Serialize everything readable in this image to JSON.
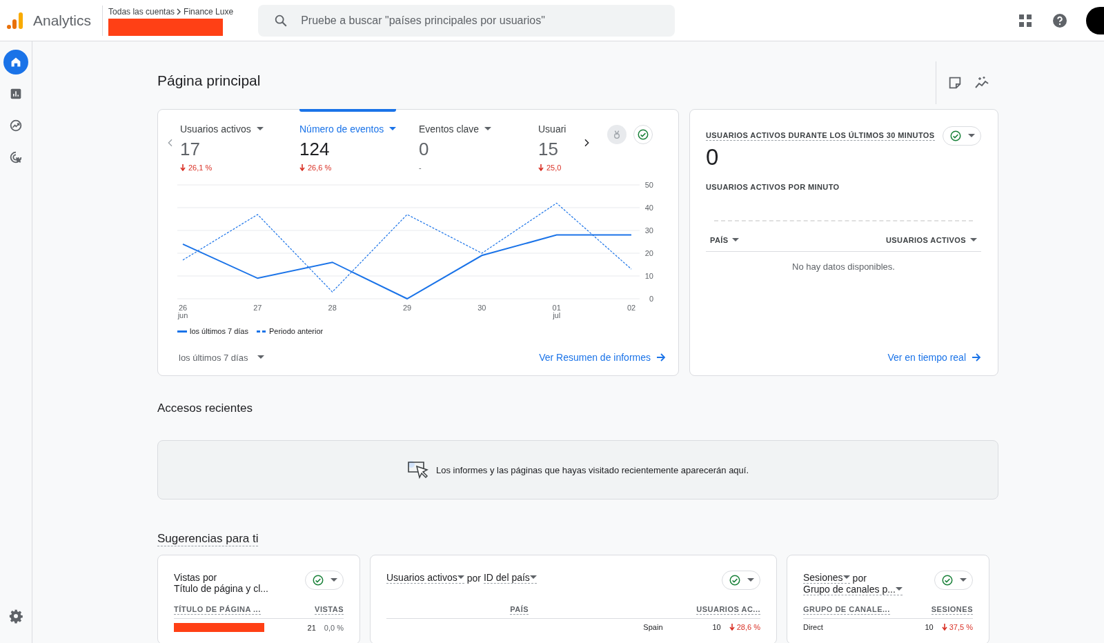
{
  "header": {
    "product": "Analytics",
    "breadcrumb": [
      "Todas las cuentas",
      "Finance Luxe"
    ],
    "search": {
      "placeholder": "Pruebe a buscar \"países principales por usuarios\""
    }
  },
  "sidebar": {
    "items": [
      {
        "selected": true
      },
      {
        "selected": false
      },
      {
        "selected": false
      },
      {
        "selected": false
      }
    ]
  },
  "page_title": "Página principal",
  "overview": {
    "metrics": [
      {
        "label": "Usuarios activos",
        "value": "17",
        "change": "26,1 %",
        "decrease": true,
        "selected": false
      },
      {
        "label": "Número de eventos",
        "value": "124",
        "change": "26,6 %",
        "decrease": true,
        "selected": true
      },
      {
        "label": "Eventos clave",
        "value": "0",
        "change": "-",
        "decrease": false,
        "selected": false
      },
      {
        "label": "Usuari",
        "value": "15",
        "change": "25,0",
        "decrease": true,
        "selected": false
      }
    ],
    "chart_data": {
      "type": "line",
      "grid": true,
      "categories": [
        "26 jun",
        "27",
        "28",
        "29",
        "30",
        "01 jul",
        "02"
      ],
      "ylim": [
        0,
        50
      ],
      "yticks": [
        0,
        10,
        20,
        30,
        40,
        50
      ],
      "series": [
        {
          "name": "los últimos 7 días",
          "color": "#1a73e8",
          "line_style": "solid",
          "values": [
            24,
            9,
            16,
            0,
            19,
            28,
            28
          ]
        },
        {
          "name": "Periodo anterior",
          "color": "#1a73e8",
          "line_style": "dashed",
          "values": [
            17,
            37,
            3,
            37,
            20,
            42,
            13
          ]
        }
      ]
    },
    "date_range": "los últimos 7 días",
    "link": "Ver Resumen de informes"
  },
  "realtime": {
    "title": "USUARIOS ACTIVOS DURANTE LOS ÚLTIMOS 30 MINUTOS",
    "value": "0",
    "subtitle": "USUARIOS ACTIVOS POR MINUTO",
    "columns": [
      "PAÍS",
      "USUARIOS ACTIVOS"
    ],
    "empty": "No hay datos disponibles.",
    "link": "Ver en tiempo real"
  },
  "recent": {
    "heading": "Accesos recientes",
    "message": "Los informes y las páginas que hayas visitado recientemente aparecerán aquí."
  },
  "suggestions": {
    "heading": "Sugerencias para ti",
    "cards": [
      {
        "title_lines": [
          [
            {
              "text": "Vistas",
              "dropdown": false
            },
            {
              "text": "por",
              "dropdown": false
            }
          ],
          [
            {
              "text": "Título de página y cl...",
              "dropdown": false
            }
          ]
        ],
        "columns": [
          "TÍTULO DE PÁGINA ...",
          "VISTAS"
        ],
        "rows": [
          {
            "label": "",
            "redacted": true,
            "value": "21",
            "change": "0,0 %",
            "decrease": false
          }
        ]
      },
      {
        "title_lines": [
          [
            {
              "text": "Usuarios activos",
              "dropdown": true
            },
            {
              "text": "por",
              "dropdown": false
            },
            {
              "text": "ID del país",
              "dropdown": true
            }
          ]
        ],
        "columns": [
          "PAÍS",
          "USUARIOS AC..."
        ],
        "rows": [
          {
            "label": "Spain",
            "redacted": false,
            "value": "10",
            "change": "28,6 %",
            "decrease": true
          }
        ]
      },
      {
        "title_lines": [
          [
            {
              "text": "Sesiones",
              "dropdown": true
            },
            {
              "text": "por",
              "dropdown": false
            }
          ],
          [
            {
              "text": "Grupo de canales p...",
              "dropdown": true
            }
          ]
        ],
        "columns": [
          "GRUPO DE CANALE...",
          "SESIONES"
        ],
        "rows": [
          {
            "label": "Direct",
            "redacted": false,
            "value": "10",
            "change": "37,5 %",
            "decrease": true
          }
        ]
      }
    ]
  }
}
